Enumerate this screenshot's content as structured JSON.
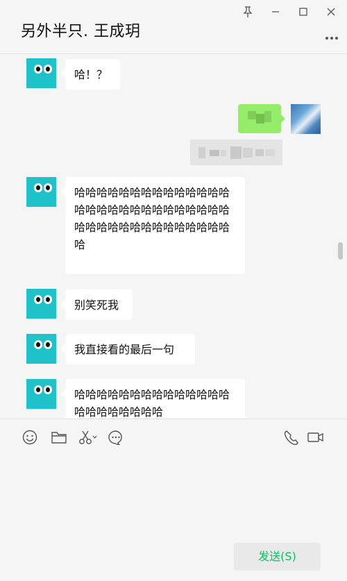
{
  "window": {
    "title": "另外半只. 王成玥"
  },
  "messages": [
    {
      "text": "哈！？"
    },
    {
      "text": "哈哈哈哈哈哈哈哈哈哈哈哈哈哈哈哈哈哈哈哈哈哈哈哈哈哈哈哈哈哈哈哈哈哈哈哈哈哈哈哈哈哈哈"
    },
    {
      "text": "别笑死我"
    },
    {
      "text": "我直接看的最后一句"
    },
    {
      "text": "哈哈哈哈哈哈哈哈哈哈哈哈哈哈哈哈哈哈哈哈哈哈"
    }
  ],
  "composer": {
    "send_label": "发送(S)"
  },
  "icons": {
    "pin": "pin-icon",
    "minimize": "minimize-icon",
    "maximize": "maximize-icon",
    "close": "close-icon",
    "more": "more-icon",
    "emoji": "emoji-icon",
    "folder": "folder-icon",
    "scissors": "scissors-icon",
    "chat": "chat-bubble-icon",
    "phone": "phone-icon",
    "video": "video-icon"
  },
  "colors": {
    "accent_green": "#07c160",
    "sent_bubble": "#95ec69",
    "avatar": "#1fc2c8"
  }
}
